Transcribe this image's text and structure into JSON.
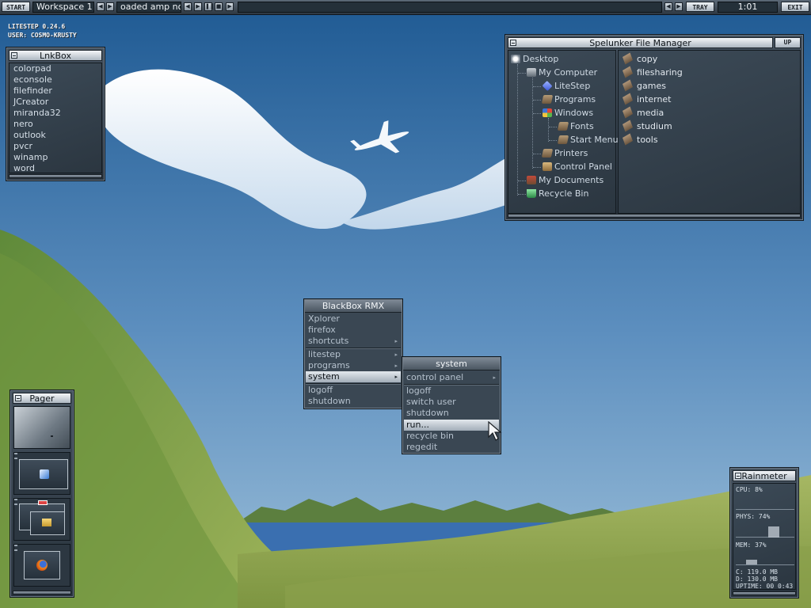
{
  "taskbar": {
    "start_label": "START",
    "workspace": "Workspace 1",
    "ticker": "oaded  amp not",
    "tray_label": "TRAY",
    "clock": "1:01",
    "exit_label": "EXIT"
  },
  "info": {
    "version": "LITESTEP 0.24.6",
    "user": "USER: COSMO-KRUSTY"
  },
  "lnkbox": {
    "title": "LnkBox",
    "items": [
      "colorpad",
      "econsole",
      "filefinder",
      "JCreator",
      "miranda32",
      "nero",
      "outlook",
      "pvcr",
      "winamp",
      "word"
    ]
  },
  "file_manager": {
    "title": "Spelunker File Manager",
    "up_label": "UP",
    "tree": [
      {
        "label": "Desktop",
        "icon": "desktop-icon"
      },
      {
        "label": "My Computer",
        "icon": "computer-icon"
      },
      {
        "label": "LiteStep",
        "icon": "litestep-cube-icon"
      },
      {
        "label": "Programs",
        "icon": "folder-icon"
      },
      {
        "label": "Windows",
        "icon": "windows-folder-icon"
      },
      {
        "label": "Fonts",
        "icon": "folder-icon"
      },
      {
        "label": "Start Menu",
        "icon": "folder-icon"
      },
      {
        "label": "Printers",
        "icon": "printer-icon"
      },
      {
        "label": "Control Panel",
        "icon": "control-panel-icon"
      },
      {
        "label": "My Documents",
        "icon": "documents-icon"
      },
      {
        "label": "Recycle Bin",
        "icon": "recycle-bin-icon"
      }
    ],
    "folders": [
      "copy",
      "filesharing",
      "games",
      "internet",
      "media",
      "studium",
      "tools"
    ]
  },
  "blackbox_menu": {
    "title": "BlackBox RMX",
    "groups": [
      [
        {
          "label": "Xplorer",
          "submenu": false
        },
        {
          "label": "firefox",
          "submenu": false
        },
        {
          "label": "shortcuts",
          "submenu": true
        }
      ],
      [
        {
          "label": "litestep",
          "submenu": true
        },
        {
          "label": "programs",
          "submenu": true
        },
        {
          "label": "system",
          "submenu": true,
          "selected": true
        },
        {
          "label": "logoff",
          "submenu": false
        },
        {
          "label": "shutdown",
          "submenu": false
        }
      ]
    ]
  },
  "system_menu": {
    "title": "system",
    "items": [
      {
        "label": "control panel",
        "submenu": true
      },
      {
        "label": "logoff"
      },
      {
        "label": "switch user"
      },
      {
        "label": "shutdown"
      },
      {
        "label": "run...",
        "selected": true
      },
      {
        "label": "recycle bin"
      },
      {
        "label": "regedit"
      }
    ]
  },
  "pager": {
    "title": "Pager",
    "desktops": [
      {
        "app_icon": "window-mark-icon"
      },
      {
        "app_icon": "app-globe-icon"
      },
      {
        "app_icon": "folder-window-icon"
      },
      {
        "app_icon": "firefox-icon"
      }
    ]
  },
  "rainmeter": {
    "title": "Rainmeter",
    "cpu": "CPU: 8%",
    "cpu_value": 8,
    "phys": "PHYS: 74%",
    "phys_value": 74,
    "mem": "MEM: 37%",
    "mem_value": 37,
    "disk_c": "C: 119.0 MB",
    "disk_d": "D: 130.0 MB",
    "uptime": "UPTIME: 00 0:43"
  },
  "colors": {
    "sky_top": "#1f5a93",
    "sky_bottom": "#8fb6d6",
    "hill": "#7e9b45",
    "water": "#3a6fb0",
    "window_dark": "#2b3640"
  }
}
